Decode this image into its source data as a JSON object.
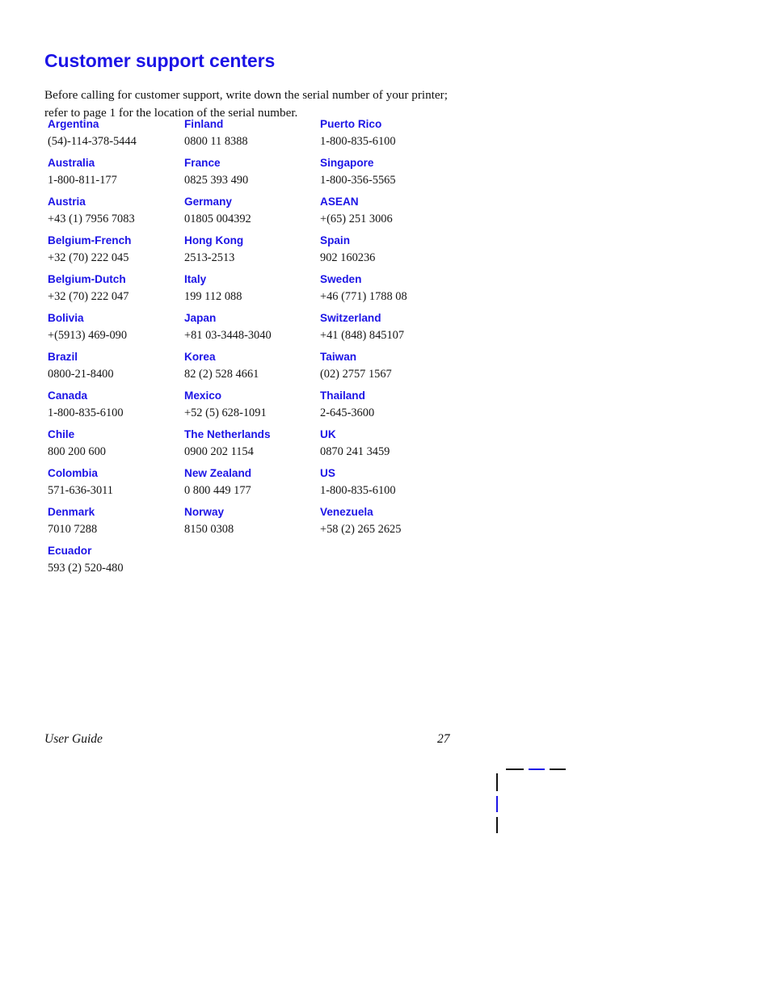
{
  "document": {
    "title": "Customer support centers",
    "intro": "Before calling for customer support, write down the serial number of your printer; refer to page 1 for the location of the serial number."
  },
  "colors": {
    "accent_blue": "#1c14e6",
    "body_text": "#141414",
    "page_background": "#ffffff"
  },
  "contacts": {
    "columns": [
      {
        "entries": [
          {
            "country": "Argentina",
            "phone": "(54)-114-378-5444"
          },
          {
            "country": "Australia",
            "phone": "1-800-811-177"
          },
          {
            "country": "Austria",
            "phone": "+43 (1) 7956 7083"
          },
          {
            "country": "Belgium-French",
            "phone": "+32 (70) 222 045"
          },
          {
            "country": "Belgium-Dutch",
            "phone": "+32 (70) 222 047"
          },
          {
            "country": "Bolivia",
            "phone": "+(5913) 469-090"
          },
          {
            "country": "Brazil",
            "phone": "0800-21-8400"
          },
          {
            "country": "Canada",
            "phone": "1-800-835-6100"
          },
          {
            "country": "Chile",
            "phone": "800 200 600"
          },
          {
            "country": "Colombia",
            "phone": "571-636-3011"
          },
          {
            "country": "Denmark",
            "phone": "7010 7288"
          },
          {
            "country": "Ecuador",
            "phone": "593 (2) 520-480"
          }
        ]
      },
      {
        "entries": [
          {
            "country": "Finland",
            "phone": "0800 11 8388"
          },
          {
            "country": "France",
            "phone": "0825 393 490"
          },
          {
            "country": "Germany",
            "phone": "01805 004392"
          },
          {
            "country": "Hong Kong",
            "phone": "2513-2513"
          },
          {
            "country": "Italy",
            "phone": "199 112 088"
          },
          {
            "country": "Japan",
            "phone": "+81 03-3448-3040"
          },
          {
            "country": "Korea",
            "phone": "82 (2) 528 4661"
          },
          {
            "country": "Mexico",
            "phone": "+52 (5) 628-1091"
          },
          {
            "country": "The Netherlands",
            "phone": "0900 202 1154"
          },
          {
            "country": "New Zealand",
            "phone": "0 800 449 177"
          },
          {
            "country": "Norway",
            "phone": "8150 0308"
          }
        ]
      },
      {
        "entries": [
          {
            "country": "Puerto Rico",
            "phone": "1-800-835-6100"
          },
          {
            "country": "Singapore",
            "phone": "1-800-356-5565"
          },
          {
            "country": "ASEAN",
            "phone": "+(65) 251 3006"
          },
          {
            "country": "Spain",
            "phone": "902 160236"
          },
          {
            "country": "Sweden",
            "phone": "+46 (771) 1788 08"
          },
          {
            "country": "Switzerland",
            "phone": "+41 (848) 845107"
          },
          {
            "country": "Taiwan",
            "phone": "(02) 2757 1567"
          },
          {
            "country": "Thailand",
            "phone": "2-645-3600"
          },
          {
            "country": "UK",
            "phone": "0870 241 3459"
          },
          {
            "country": "US",
            "phone": "1-800-835-6100"
          },
          {
            "country": "Venezuela",
            "phone": "+58 (2) 265 2625"
          }
        ]
      }
    ]
  },
  "footer": {
    "label": "User Guide",
    "page_number": "27"
  }
}
